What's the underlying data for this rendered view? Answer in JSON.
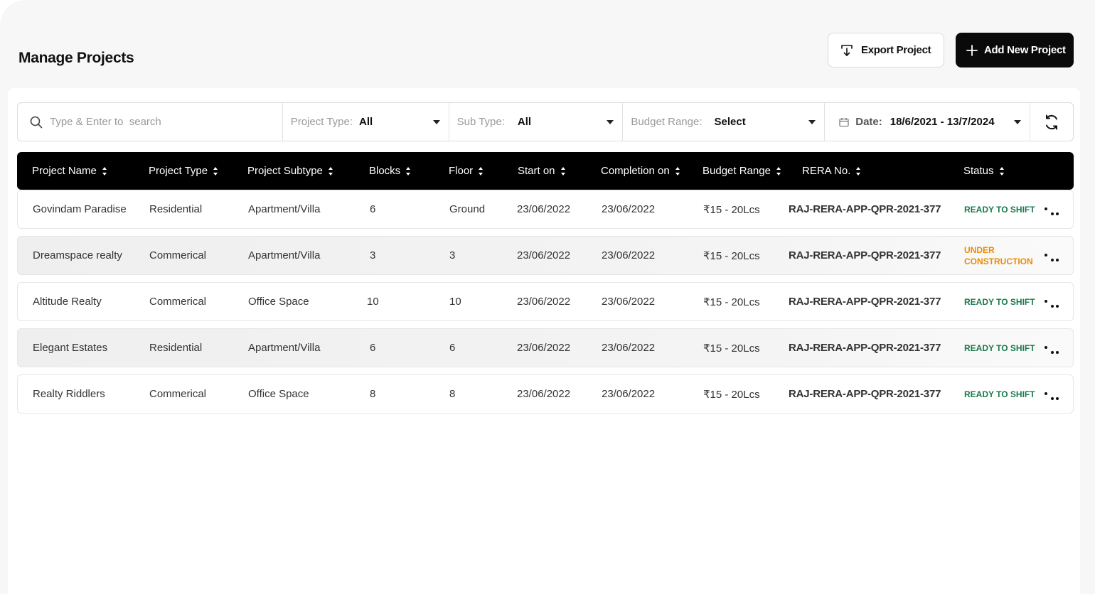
{
  "page": {
    "title": "Manage Projects"
  },
  "actions": {
    "export_label": "Export Project",
    "add_label": "Add New Project"
  },
  "filters": {
    "search_placeholder": "Type & Enter to  search",
    "project_type": {
      "label": "Project Type:",
      "value": "All"
    },
    "sub_type": {
      "label": "Sub Type:",
      "value": "All"
    },
    "budget_range": {
      "label": "Budget Range:",
      "value": "Select"
    },
    "date": {
      "label": "Date:",
      "value": "18/6/2021 - 13/7/2024"
    }
  },
  "table": {
    "columns": [
      "Project Name",
      "Project Type",
      "Project Subtype",
      "Blocks",
      "Floor",
      "Start on",
      "Completion on",
      "Budget Range",
      "RERA No.",
      "Status"
    ],
    "rows": [
      {
        "name": "Govindam Paradise",
        "type": "Residential",
        "subtype": "Apartment/Villa",
        "blocks": "6",
        "floor": "Ground",
        "start": "23/06/2022",
        "completion": "23/06/2022",
        "budget": "₹15 - 20Lcs",
        "rera": "RAJ-RERA-APP-QPR-2021-377",
        "status": "READY TO SHIFT",
        "status_kind": "ready"
      },
      {
        "name": "Dreamspace realty",
        "type": "Commerical",
        "subtype": "Apartment/Villa",
        "blocks": "3",
        "floor": "3",
        "start": "23/06/2022",
        "completion": "23/06/2022",
        "budget": "₹15 - 20Lcs",
        "rera": "RAJ-RERA-APP-QPR-2021-377",
        "status": "UNDER CONSTRUCTION",
        "status_kind": "under"
      },
      {
        "name": "Altitude Realty",
        "type": "Commerical",
        "subtype": "Office Space",
        "blocks": "10",
        "floor": "10",
        "start": "23/06/2022",
        "completion": "23/06/2022",
        "budget": "₹15 - 20Lcs",
        "rera": "RAJ-RERA-APP-QPR-2021-377",
        "status": "READY TO SHIFT",
        "status_kind": "ready"
      },
      {
        "name": "Elegant Estates",
        "type": "Residential",
        "subtype": "Apartment/Villa",
        "blocks": "6",
        "floor": "6",
        "start": "23/06/2022",
        "completion": "23/06/2022",
        "budget": "₹15 - 20Lcs",
        "rera": "RAJ-RERA-APP-QPR-2021-377",
        "status": "READY TO SHIFT",
        "status_kind": "ready"
      },
      {
        "name": "Realty Riddlers",
        "type": "Commerical",
        "subtype": "Office Space",
        "blocks": "8",
        "floor": "8",
        "start": "23/06/2022",
        "completion": "23/06/2022",
        "budget": "₹15 - 20Lcs",
        "rera": "RAJ-RERA-APP-QPR-2021-377",
        "status": "READY TO SHIFT",
        "status_kind": "ready"
      }
    ]
  },
  "icons": {
    "export": "export-icon",
    "add": "plus-icon",
    "search": "search-icon",
    "calendar": "calendar-icon",
    "refresh": "refresh-icon",
    "row_menu": "more-dots-icon"
  },
  "colors": {
    "ready": "#1a7a4c",
    "under": "#f08a00",
    "header_bg": "#000000"
  }
}
